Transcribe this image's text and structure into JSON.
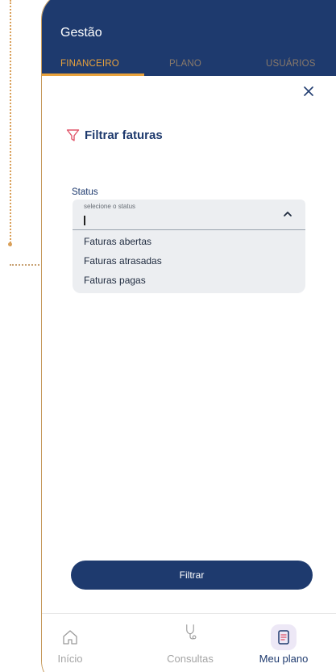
{
  "header": {
    "title": "Gestão",
    "tabs": [
      {
        "label": "FINANCEIRO",
        "active": true
      },
      {
        "label": "PLANO",
        "active": false
      },
      {
        "label": "USUÁRIOS",
        "active": false
      }
    ]
  },
  "close_icon": "close-icon",
  "filter": {
    "title": "Filtrar faturas",
    "status_label": "Status",
    "select_placeholder": "selecione o status",
    "options": [
      "Faturas abertas",
      "Faturas atrasadas",
      "Faturas pagas"
    ],
    "submit_label": "Filtrar"
  },
  "bottom_nav": [
    {
      "label": "Início",
      "icon": "home-icon",
      "active": false
    },
    {
      "label": "Consultas",
      "icon": "stethoscope-icon",
      "active": false
    },
    {
      "label": "Meu plano",
      "icon": "document-icon",
      "active": true
    }
  ],
  "colors": {
    "primary": "#1e3a6e",
    "accent": "#e8a23c",
    "filter_icon": "#e0566a",
    "frame": "#c69a5c"
  }
}
